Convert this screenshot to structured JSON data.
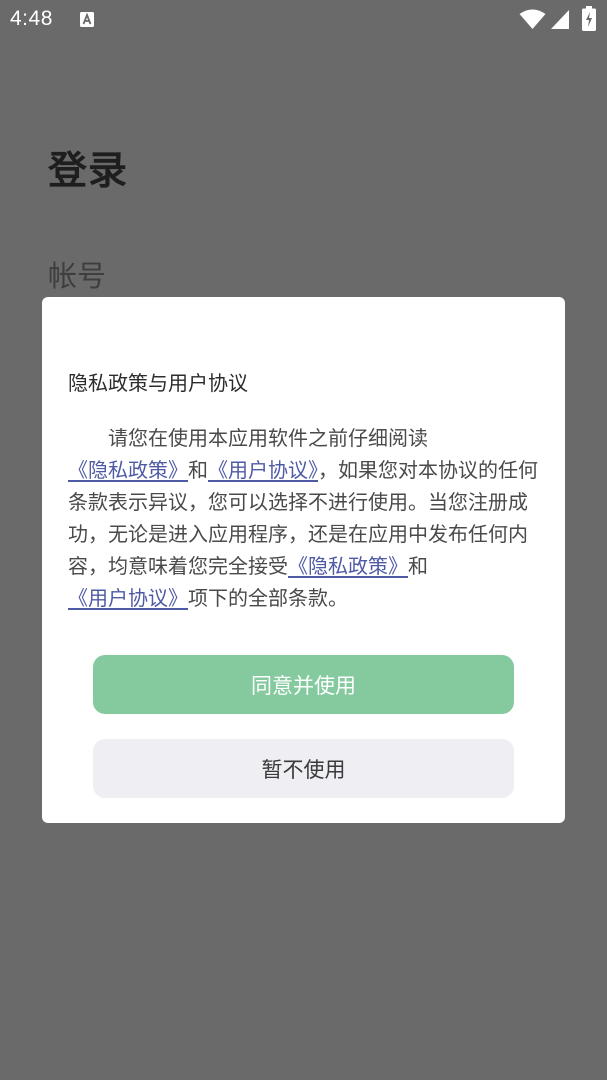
{
  "status_bar": {
    "time": "4:48",
    "icons": [
      "app-notification-icon",
      "wifi-icon",
      "cellular-signal-icon",
      "battery-charging-icon"
    ]
  },
  "login": {
    "title": "登录",
    "account_label": "帐号"
  },
  "dialog": {
    "title": "隐私政策与用户协议",
    "body": {
      "text_1": "请您在使用本应用软件之前仔细阅读",
      "link_privacy_1": "《隐私政策》",
      "text_2": "和",
      "link_agreement_1": "《用户协议》",
      "text_3": "，如果您对本协议的任何条款表示异议，您可以选择不进行使用。当您注册成功，无论是进入应用程序，还是在应用中发布任何内容，均意味着您完全接受",
      "link_privacy_2": "《隐私政策》",
      "text_4": "和",
      "link_agreement_2": "《用户协议》",
      "text_5": "项下的全部条款。"
    },
    "agree_label": "同意并使用",
    "decline_label": "暂不使用"
  },
  "colors": {
    "overlay": "#6a6a6a",
    "link": "#4f5aa5",
    "agree_button": "#85c99f",
    "decline_button": "#efeef3"
  }
}
